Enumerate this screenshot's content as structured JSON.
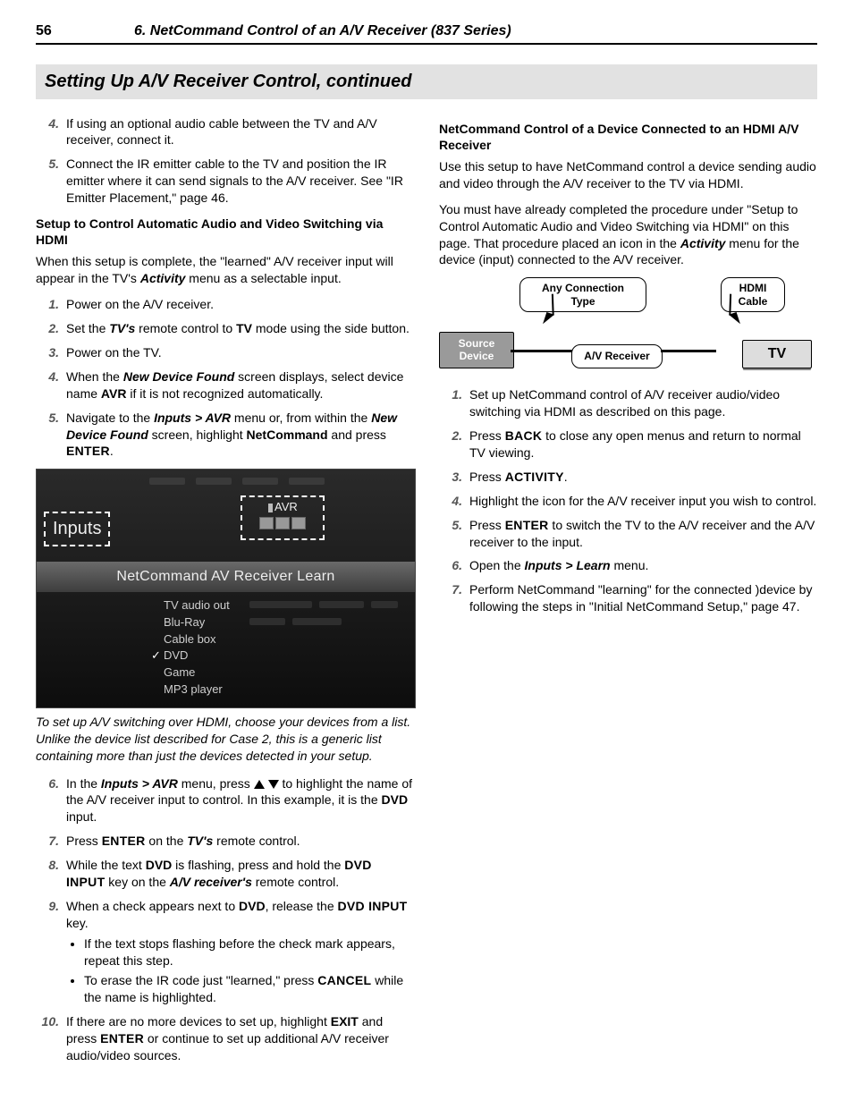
{
  "header": {
    "page_number": "56",
    "chapter": "6.  NetCommand Control of an A/V Receiver (837 Series)"
  },
  "section_title": "Setting Up A/V Receiver Control, continued",
  "left": {
    "steps_a": [
      {
        "n": "4.",
        "html": "If using an optional audio cable between the TV and A/V receiver, connect it."
      },
      {
        "n": "5.",
        "html": "Connect the IR emitter cable to the TV and position the IR emitter where it can send signals to the A/V receiver.  See \"IR Emitter Placement,\" page 46."
      }
    ],
    "subhead1": "Setup to Control Automatic Audio and Video Switching via HDMI",
    "para1_a": "When this setup is complete, the \"learned\" A/V receiver input will appear in the TV's ",
    "para1_b": "Activity",
    "para1_c": " menu as a selectable input.",
    "steps_b": [
      {
        "n": "1.",
        "html": "Power on the A/V receiver."
      },
      {
        "n": "2.",
        "html": "Set the <span class='bi'>TV's</span> remote control to <span class='b'>TV</span> mode using the side button."
      },
      {
        "n": "3.",
        "html": "Power on the TV."
      },
      {
        "n": "4.",
        "html": "When the <span class='bi'>New Device Found</span> screen displays, select device name <span class='b'>AVR</span> if it is not recognized automatically."
      },
      {
        "n": "5.",
        "html": "Navigate to the <span class='bi'>Inputs &gt; AVR</span> menu or, from within the <span class='bi'>New Device Found</span> screen, highlight <span class='b'>NetCommand</span> and press <span class='sc'>ENTER</span>."
      }
    ],
    "ui": {
      "inputs_label": "Inputs",
      "avr_label": "AVR",
      "title": "NetCommand AV Receiver Learn",
      "list": [
        "TV audio out",
        "Blu-Ray",
        "Cable box",
        "DVD",
        "Game",
        "MP3 player"
      ],
      "checked_index": 3
    },
    "caption": "To set up A/V switching over HDMI, choose your devices from a list.  Unlike the device list described for Case 2, this is a generic list containing more than just the devices detected in your setup.",
    "steps_c": [
      {
        "n": "6.",
        "html": "In the <span class='bi'>Inputs &gt; AVR</span> menu, press <span class='tri-up'></span> <span class='tri-down'></span> to highlight the name of the A/V receiver input to control.  In this example, it is the <span class='b'>DVD</span> input."
      },
      {
        "n": "7.",
        "html": "Press <span class='sc'>ENTER</span> on the <span class='bi'>TV's</span> remote control."
      },
      {
        "n": "8.",
        "html": "While the text <span class='b'>DVD</span> is flashing, press and hold the <span class='sc'>DVD INPUT</span> key on the <span class='bi'>A/V receiver's</span> remote control."
      },
      {
        "n": "9.",
        "html": "When a check appears next to <span class='b'>DVD</span>, release the <span class='sc'>DVD INPUT</span> key.",
        "bullets": [
          "If the text stops flashing before the check mark appears, repeat this step.",
          "To erase the IR code just \"learned,\" press <span class='sc'>CANCEL</span> while the name is highlighted."
        ]
      },
      {
        "n": "10.",
        "html": "If there are no more devices to set up, highlight <span class='b'>EXIT</span> and press <span class='sc'>ENTER</span> or continue to set up additional A/V receiver audio/video sources."
      }
    ]
  },
  "right": {
    "subhead": "NetCommand Control of a Device Connected to an HDMI A/V Receiver",
    "para1": "Use this setup to have NetCommand control a device sending audio and video through the A/V receiver to the TV via HDMI.",
    "para2_a": "You must have already completed the procedure under \"Setup to Control Automatic Audio and Video Switching via HDMI\" on this page.  That procedure placed an icon in the ",
    "para2_b": "Activity",
    "para2_c": " menu for the device (input) connected to the A/V receiver.",
    "diagram": {
      "any_connection": "Any Connection Type",
      "hdmi_cable": "HDMI Cable",
      "source": "Source Device",
      "avr": "A/V Receiver",
      "tv": "TV"
    },
    "steps": [
      {
        "n": "1.",
        "html": "Set up NetCommand control of A/V receiver audio/video switching via HDMI as described on this page."
      },
      {
        "n": "2.",
        "html": "Press <span class='sc'>BACK</span> to close any open menus and return to normal TV viewing."
      },
      {
        "n": "3.",
        "html": "Press <span class='sc'>ACTIVITY</span>."
      },
      {
        "n": "4.",
        "html": "Highlight the icon for the A/V receiver input you wish to control."
      },
      {
        "n": "5.",
        "html": "Press <span class='sc'>ENTER</span> to switch the TV to the A/V receiver and the A/V receiver to the input."
      },
      {
        "n": "6.",
        "html": "Open the <span class='bi'>Inputs &gt; Learn</span> menu."
      },
      {
        "n": "7.",
        "html": "Perform NetCommand \"learning\" for the connected )device by following the steps in \"Initial NetCommand Setup,\" page 47."
      }
    ]
  }
}
